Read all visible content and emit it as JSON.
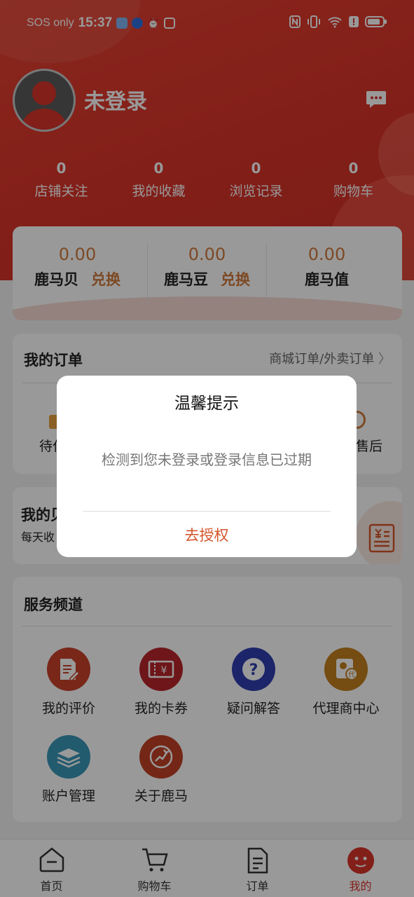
{
  "status_bar": {
    "carrier": "SOS only",
    "time": "15:37"
  },
  "profile": {
    "username": "未登录"
  },
  "stats": [
    {
      "value": "0",
      "label": "店铺关注"
    },
    {
      "value": "0",
      "label": "我的收藏"
    },
    {
      "value": "0",
      "label": "浏览记录"
    },
    {
      "value": "0",
      "label": "购物车"
    }
  ],
  "wallet": [
    {
      "value": "0.00",
      "label": "鹿马贝",
      "action": "兑换"
    },
    {
      "value": "0.00",
      "label": "鹿马豆",
      "action": "兑换"
    },
    {
      "value": "0.00",
      "label": "鹿马值"
    }
  ],
  "orders": {
    "title": "我的订单",
    "link": "商城订单/外卖订单",
    "partial_left": "待付",
    "partial_right": "售后"
  },
  "assets": {
    "title_partial": "我的贝",
    "subtitle_partial": "每天收"
  },
  "services": {
    "title": "服务频道",
    "items": [
      {
        "label": "我的评价",
        "icon": "review-icon",
        "color": "#c8412a"
      },
      {
        "label": "我的卡券",
        "icon": "coupon-icon",
        "color": "#b8262a"
      },
      {
        "label": "疑问解答",
        "icon": "question-icon",
        "color": "#2f3fb0"
      },
      {
        "label": "代理商中心",
        "icon": "agent-icon",
        "color": "#c47f1e"
      },
      {
        "label": "账户管理",
        "icon": "account-icon",
        "color": "#3a97b8"
      },
      {
        "label": "关于鹿马",
        "icon": "about-icon",
        "color": "#c24126"
      }
    ]
  },
  "tabbar": [
    {
      "label": "首页",
      "icon": "home-icon"
    },
    {
      "label": "购物车",
      "icon": "cart-icon"
    },
    {
      "label": "订单",
      "icon": "order-icon"
    },
    {
      "label": "我的",
      "icon": "mine-icon",
      "active": true
    }
  ],
  "dialog": {
    "title": "温馨提示",
    "message": "检测到您未登录或登录信息已过期",
    "button": "去授权"
  },
  "colors": {
    "brand_red": "#d9342a",
    "accent_orange": "#d07a3c",
    "dialog_button": "#d4552a"
  }
}
